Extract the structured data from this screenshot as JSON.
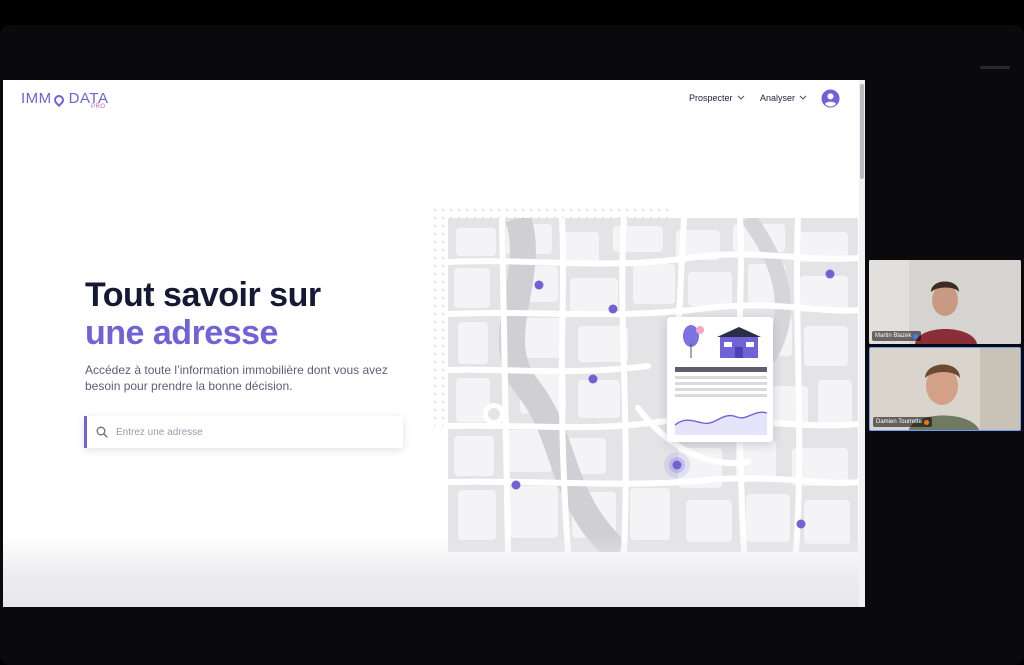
{
  "logo": {
    "left": "IMM",
    "right": "DATA",
    "suffix": "PRO"
  },
  "nav": {
    "items": [
      {
        "label": "Prospecter"
      },
      {
        "label": "Analyser"
      }
    ]
  },
  "hero": {
    "title_line1": "Tout savoir sur",
    "title_line2": "une adresse",
    "subtitle": "Accédez à toute l’information immobilière dont vous avez besoin pour prendre la bonne décision."
  },
  "search": {
    "placeholder": "Entrez une adresse",
    "value": ""
  },
  "participants": [
    {
      "name": "Martin Blazek"
    },
    {
      "name": "Damien Tourrette"
    }
  ],
  "colors": {
    "brand": "#6f63d7",
    "title": "#141a33",
    "accent_pink": "#c35bd6"
  },
  "icons": {
    "search": "search-icon",
    "user": "user-circle-icon",
    "chevron": "chevron-down-icon"
  }
}
